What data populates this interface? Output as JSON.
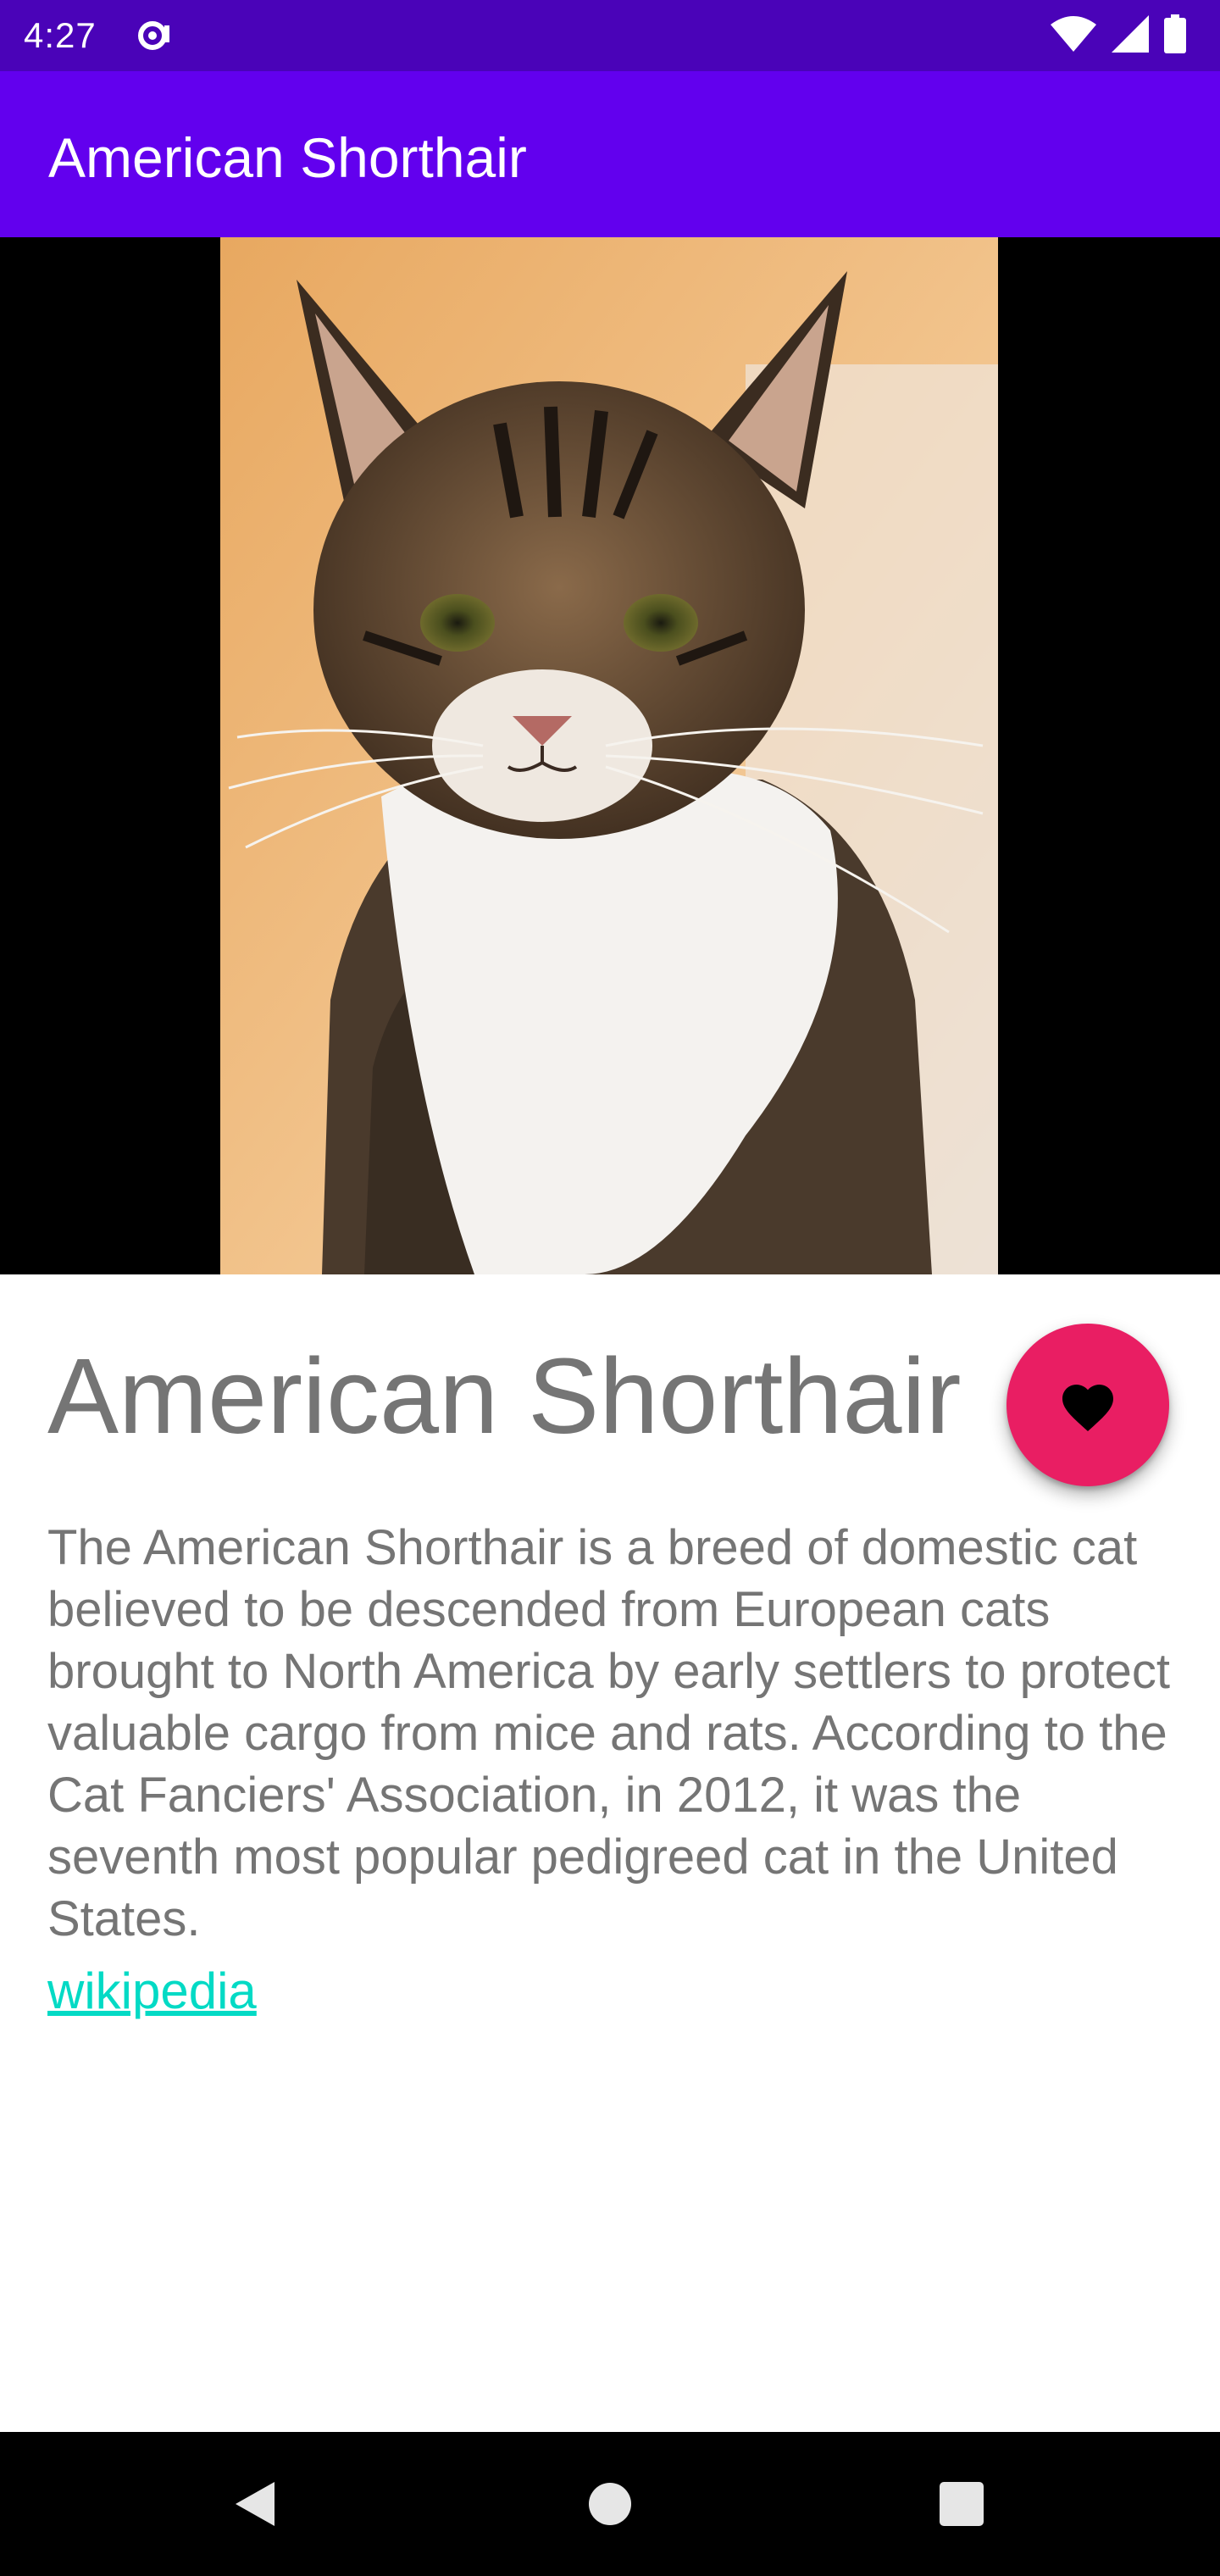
{
  "status_bar": {
    "time": "4:27",
    "icons": [
      "notification-icon",
      "wifi-icon",
      "cell-signal-icon",
      "battery-icon"
    ]
  },
  "app_bar": {
    "title": "American Shorthair"
  },
  "hero": {
    "image_subject": "tabby cat with white chest"
  },
  "detail": {
    "name": "American Shorthair",
    "description": "The American Shorthair is a breed of domestic cat believed to be descended from European cats brought to North America by early settlers to protect valuable cargo from mice and rats. According to the Cat Fanciers' Association, in 2012, it was the seventh most popular pedigreed cat in the United States.",
    "link_text": "wikipedia",
    "favorite_icon": "heart-icon"
  },
  "nav_bar": {
    "icons": [
      "back-icon",
      "home-icon",
      "recents-icon"
    ]
  },
  "colors": {
    "status_bar": "#4a03b8",
    "app_bar": "#6200ee",
    "fab": "#e91e63",
    "link": "#03dac5",
    "text": "#757575"
  }
}
